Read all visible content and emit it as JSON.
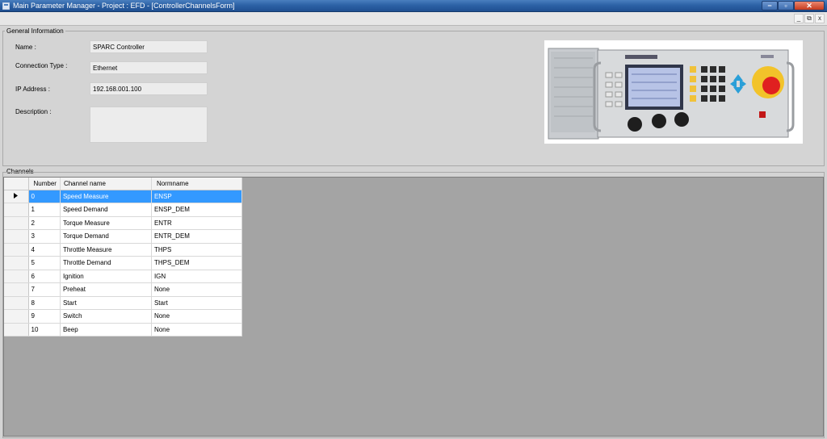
{
  "window": {
    "title": "Main Parameter Manager - Project : EFD - [ControllerChannelsForm]",
    "controls": {
      "minimize": "−",
      "maximize": "▫",
      "close": "✕"
    },
    "mdi_controls": {
      "minimize": "_",
      "restore": "⧉",
      "close": "x"
    }
  },
  "general": {
    "legend": "General Information",
    "name_label": "Name :",
    "name_value": "SPARC Controller",
    "connection_label": "Connection Type :",
    "connection_value": "Ethernet",
    "ip_label": "IP Address :",
    "ip_value": "192.168.001.100",
    "description_label": "Description :",
    "description_value": "",
    "device_image": "sparc-controller-photo"
  },
  "channels": {
    "legend": "Channels",
    "columns": {
      "number": "Number",
      "name": "Channel name",
      "normname": "Normname"
    },
    "selected_row": 0,
    "rows": [
      {
        "number": "0",
        "name": "Speed Measure",
        "normname": "ENSP"
      },
      {
        "number": "1",
        "name": "Speed Demand",
        "normname": "ENSP_DEM"
      },
      {
        "number": "2",
        "name": "Torque Measure",
        "normname": "ENTR"
      },
      {
        "number": "3",
        "name": "Torque Demand",
        "normname": "ENTR_DEM"
      },
      {
        "number": "4",
        "name": "Throttle Measure",
        "normname": "THPS"
      },
      {
        "number": "5",
        "name": "Throttle Demand",
        "normname": "THPS_DEM"
      },
      {
        "number": "6",
        "name": "Ignition",
        "normname": "IGN"
      },
      {
        "number": "7",
        "name": "Preheat",
        "normname": "None"
      },
      {
        "number": "8",
        "name": "Start",
        "normname": "Start"
      },
      {
        "number": "9",
        "name": "Switch",
        "normname": "None"
      },
      {
        "number": "10",
        "name": "Beep",
        "normname": "None"
      }
    ]
  },
  "colors": {
    "titlebar": "#2d62a6",
    "selection": "#3399ff",
    "grid_background": "#a4a4a4",
    "estop": "#e02020"
  }
}
